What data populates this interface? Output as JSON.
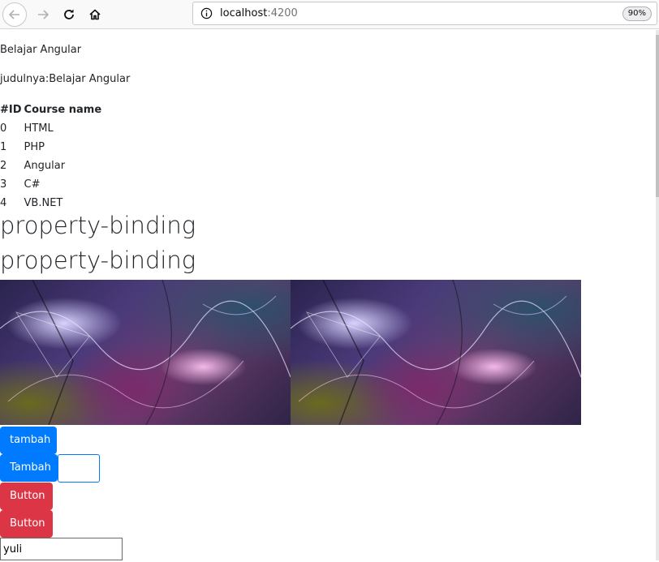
{
  "browser": {
    "url_host": "localhost",
    "url_port": ":4200",
    "zoom": "90%",
    "icons": {
      "back": "back-arrow-icon",
      "forward": "forward-arrow-icon",
      "reload": "reload-icon",
      "home": "home-icon",
      "info": "info-icon"
    }
  },
  "page": {
    "title": "Belajar Angular",
    "judul": "judulnya:Belajar Angular",
    "table": {
      "headers": [
        "#ID",
        "Course name"
      ],
      "rows": [
        [
          "0",
          "HTML"
        ],
        [
          "1",
          "PHP"
        ],
        [
          "2",
          "Angular"
        ],
        [
          "3",
          "C#"
        ],
        [
          "4",
          "VB.NET"
        ]
      ]
    },
    "heading1": "property-binding",
    "heading2": "property-binding",
    "buttons": {
      "tambah_lower": "tambah",
      "tambah_upper": "Tambah",
      "button1": "Button",
      "button2": "Button"
    },
    "name_input_value": "yuli",
    "colors": {
      "primary": "#007bff",
      "danger": "#dc3545"
    }
  }
}
